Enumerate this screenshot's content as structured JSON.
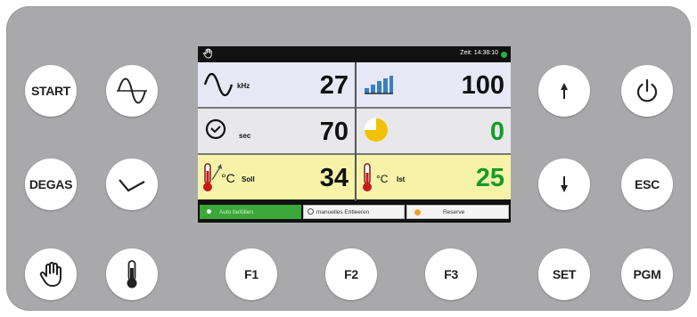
{
  "left_buttons": {
    "start": "START",
    "degas": "DEGAS"
  },
  "function_buttons": [
    "F1",
    "F2",
    "F3"
  ],
  "right_buttons": {
    "esc": "ESC",
    "set": "SET",
    "pgm": "PGM"
  },
  "display": {
    "status_time": "Zeit: 14:38:10",
    "frequency": {
      "unit": "kHz",
      "value": "27"
    },
    "power": {
      "value": "100"
    },
    "time": {
      "unit": "sec",
      "value": "70"
    },
    "progress": {
      "value": "0",
      "pie_fraction": 0.75
    },
    "temp_target": {
      "unit": "°C",
      "label": "Soll",
      "value": "34"
    },
    "temp_actual": {
      "unit": "°C",
      "label": "Ist",
      "value": "25"
    },
    "tabs": [
      "Auto befüllen",
      "manuelles Entleeren",
      "Reserve"
    ]
  },
  "colors": {
    "panel": "#a9a9ab",
    "value_green": "#169b2a",
    "tab_active": "#3aa83a",
    "progress_pie": "#f2c200",
    "reserve_dot": "#f0a020",
    "status_led": "#25b04a"
  }
}
